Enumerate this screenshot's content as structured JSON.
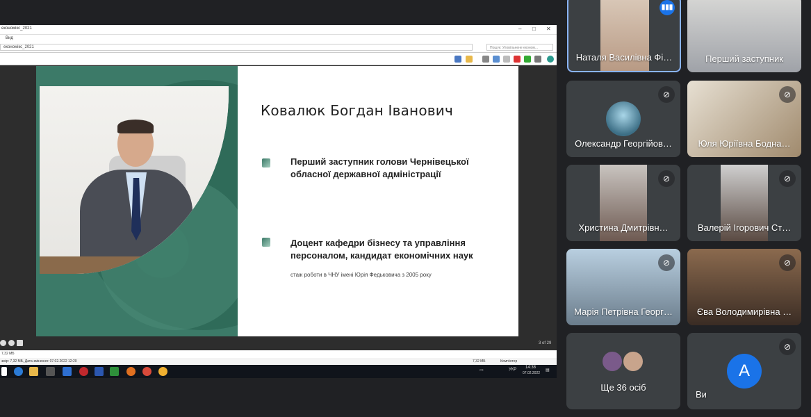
{
  "explorer": {
    "window_title": "економікс_2021",
    "menu_label": "Вид",
    "address_path": "економікс_2021",
    "search_placeholder": "Пошук: Уповільнене економ...",
    "window_minimize": "–",
    "window_maximize": "□",
    "window_close": "✕"
  },
  "slide": {
    "name": "Ковалюк Богдан Іванович",
    "bullet1": "Перший заступник голови Чернівецької обласної державної адміністрації",
    "bullet2": "Доцент кафедри бізнесу та управління персоналом, кандидат економічних наук",
    "subnote": "стаж роботи в ЧНУ імені Юрія Федьковича з 2005 року",
    "page_counter": "3 of 29"
  },
  "status": {
    "size_left": "7,32 МБ",
    "details": "змір: 7,32 МБ, Дата змінення: 07.02.2022 12:20",
    "size_right": "7,32 МБ",
    "location": "Комп'ютер"
  },
  "taskbar": {
    "lang": "УКР",
    "time": "14:38",
    "date": "07.02.2022"
  },
  "participants": [
    {
      "name": "Наталя Василівна Фі…",
      "state": "speaking"
    },
    {
      "name": "Перший заступник",
      "state": "none"
    },
    {
      "name": "Олександр Георгійов…",
      "state": "muted"
    },
    {
      "name": "Юля Юріївна Бодна…",
      "state": "muted"
    },
    {
      "name": "Христина Дмитрівн…",
      "state": "muted"
    },
    {
      "name": "Валерій Ігорович Ст…",
      "state": "muted"
    },
    {
      "name": "Марія Петрівна Георг…",
      "state": "muted"
    },
    {
      "name": "Єва Володимирівна …",
      "state": "muted"
    }
  ],
  "others": {
    "label": "Ще 36 осіб"
  },
  "self": {
    "name": "Ви",
    "initial": "A"
  },
  "icons": {
    "speaking": "audio-level-icon",
    "muted": "mic-off-icon"
  }
}
